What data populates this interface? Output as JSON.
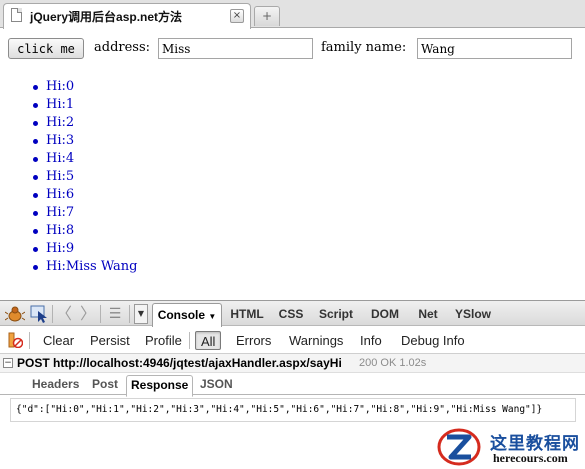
{
  "browser": {
    "tab_title": "jQuery调用后台asp.net方法",
    "tab_close_glyph": "×",
    "new_tab_glyph": "+"
  },
  "page": {
    "button_label": "click me",
    "address_label": "address:",
    "address_value": "Miss",
    "family_label": "family name:",
    "family_value": "Wang",
    "list_items": [
      "Hi:0",
      "Hi:1",
      "Hi:2",
      "Hi:3",
      "Hi:4",
      "Hi:5",
      "Hi:6",
      "Hi:7",
      "Hi:8",
      "Hi:9",
      "Hi:Miss Wang"
    ]
  },
  "firebug": {
    "panel_tabs": {
      "console": "Console",
      "html": "HTML",
      "css": "CSS",
      "script": "Script",
      "dom": "DOM",
      "net": "Net",
      "yslow": "YSlow"
    },
    "console_bar": {
      "clear": "Clear",
      "persist": "Persist",
      "profile": "Profile",
      "all": "All",
      "errors": "Errors",
      "warnings": "Warnings",
      "info": "Info",
      "debug_info": "Debug Info"
    },
    "request": {
      "line": "POST http://localhost:4946/jqtest/ajaxHandler.aspx/sayHi",
      "status": "200 OK 1.02s"
    },
    "detail_tabs": {
      "headers": "Headers",
      "post": "Post",
      "response": "Response",
      "json": "JSON"
    },
    "response_body": "{\"d\":[\"Hi:0\",\"Hi:1\",\"Hi:2\",\"Hi:3\",\"Hi:4\",\"Hi:5\",\"Hi:6\",\"Hi:7\",\"Hi:8\",\"Hi:9\",\"Hi:Miss Wang\"]}"
  },
  "watermark": {
    "title": "这里教程网",
    "url": "herecours.com"
  },
  "colors": {
    "link_blue": "#0000c0",
    "watermark_blue": "#1a4f9e",
    "watermark_red": "#d52b1e"
  }
}
